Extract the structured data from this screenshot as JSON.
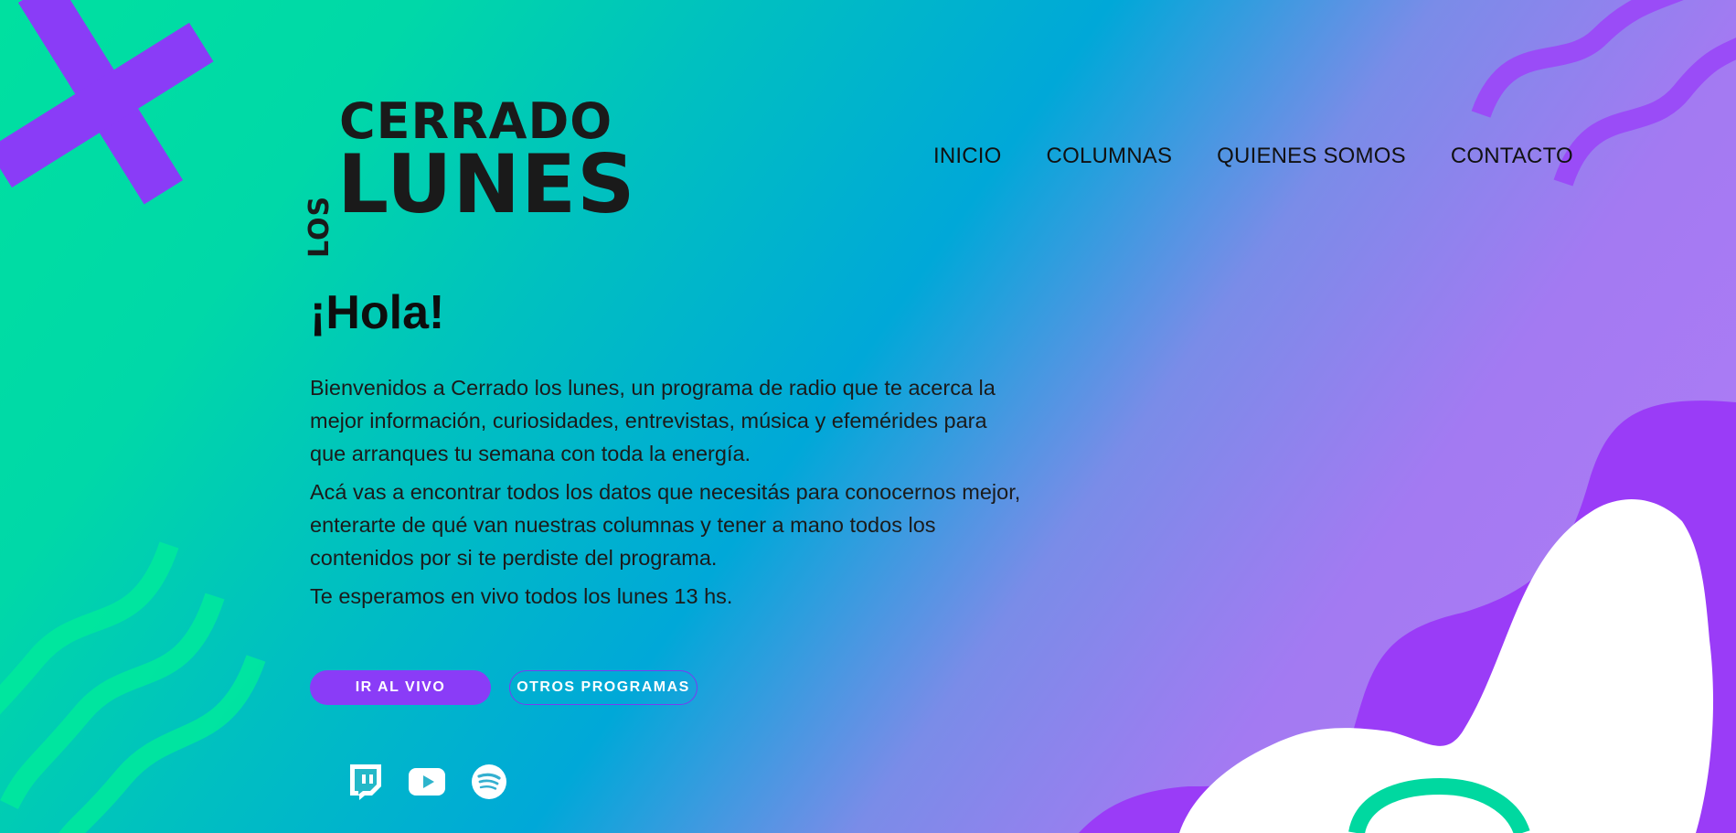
{
  "brand": {
    "logo_top": "CERRADO",
    "logo_side": "LOS",
    "logo_bottom": "LUNES"
  },
  "nav": {
    "items": [
      {
        "label": "INICIO"
      },
      {
        "label": "COLUMNAS"
      },
      {
        "label": "QUIENES SOMOS"
      },
      {
        "label": "CONTACTO"
      }
    ]
  },
  "hero": {
    "title": "¡Hola!",
    "paragraphs": [
      "Bienvenidos a Cerrado los lunes, un programa de radio que te acerca la mejor información, curiosidades, entrevistas, música y efemérides para que arranques tu semana con toda la energía.",
      "Acá vas a encontrar todos los datos que necesitás para conocernos mejor, enterarte de qué van nuestras columnas y tener a mano todos los contenidos por si te perdiste del programa.",
      "Te esperamos en vivo todos los lunes 13 hs."
    ]
  },
  "buttons": {
    "live_label": "IR AL VIVO",
    "other_label": "OTROS PROGRAMAS"
  },
  "socials": [
    {
      "icon": "twitch-icon"
    },
    {
      "icon": "youtube-icon"
    },
    {
      "icon": "spotify-icon"
    }
  ],
  "colors": {
    "accent_purple": "#8a3cf7",
    "wave_green": "#00e89a",
    "blob_white": "#ffffff",
    "text_dark": "#111111"
  }
}
